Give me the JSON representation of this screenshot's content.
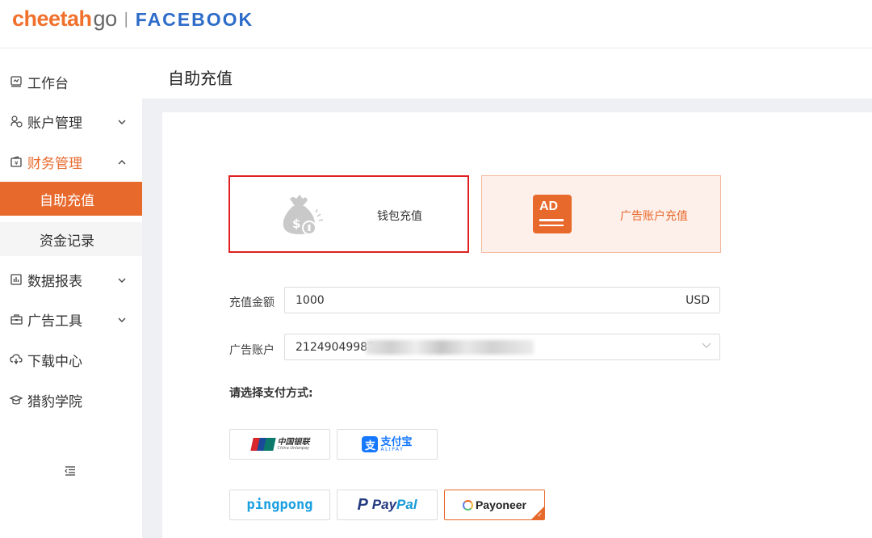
{
  "header": {
    "logo_part1": "cheetah",
    "logo_part2": "go",
    "logo_separator": "|",
    "logo_platform": "FACEBOOK"
  },
  "sidebar": {
    "items": [
      {
        "label": "工作台",
        "icon": "dashboard-icon"
      },
      {
        "label": "账户管理",
        "icon": "accounts-icon",
        "chevron": "⌄"
      },
      {
        "label": "财务管理",
        "icon": "wallet-icon",
        "chevron": "⌃",
        "open": true
      },
      {
        "label": "数据报表",
        "icon": "chart-icon",
        "chevron": "⌄"
      },
      {
        "label": "广告工具",
        "icon": "briefcase-icon",
        "chevron": "⌄"
      },
      {
        "label": "下载中心",
        "icon": "cloud-download-icon"
      },
      {
        "label": "猎豹学院",
        "icon": "graduation-cap-icon"
      }
    ],
    "sub_items": [
      {
        "label": "自助充值",
        "active": true
      },
      {
        "label": "资金记录",
        "active": false
      }
    ]
  },
  "page": {
    "title": "自助充值"
  },
  "recharge_options": {
    "wallet_label": "钱包充值",
    "ad_account_label": "广告账户充值",
    "ad_icon_text": "AD"
  },
  "form": {
    "amount_label": "充值金额",
    "amount_value": "1000",
    "amount_currency": "USD",
    "ad_account_label": "广告账户",
    "ad_account_value": "21249049985",
    "payment_title": "请选择支付方式:"
  },
  "payment_methods": {
    "unionpay_cn": "中国银联",
    "unionpay_en": "China Unionpay",
    "alipay_cn": "支付宝",
    "alipay_en": "ALIPAY",
    "alipay_mark": "支",
    "pingpong": "pingpong",
    "paypal_part1": "Pay",
    "paypal_part2": "Pal",
    "paypal_mark": "P",
    "payoneer": "Payoneer",
    "selected": "payoneer"
  },
  "colors": {
    "brand": "#e8692c",
    "facebook_blue": "#2d6cc9",
    "selected_border": "#e02020"
  }
}
